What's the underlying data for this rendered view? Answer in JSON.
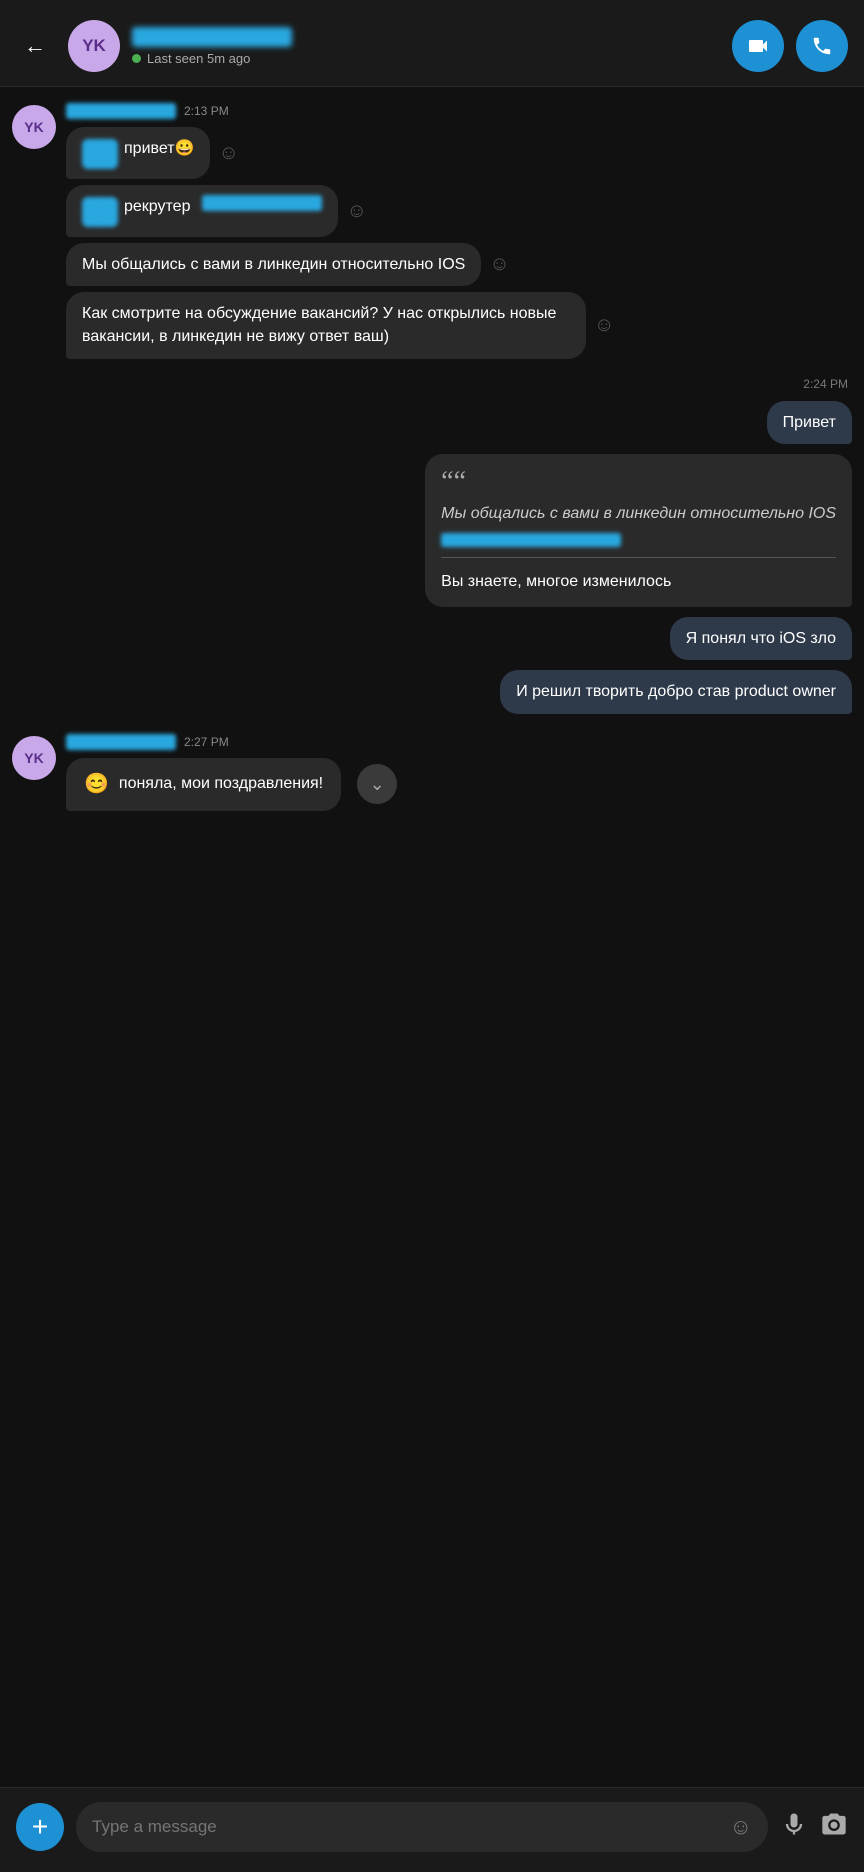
{
  "header": {
    "back_label": "←",
    "avatar_initials": "YK",
    "status_text": "Last seen 5m ago",
    "video_icon": "📹",
    "call_icon": "📞"
  },
  "messages": {
    "time1": "2:13 PM",
    "msg1_emoji": "😊",
    "msg1_text": "привет😀",
    "msg2_text": "рекрутер",
    "msg3_text": "Мы общались с вами в линкедин относительно IOS",
    "msg4_text": "Как смотрите на обсуждение вакансий? У нас открылись новые вакансии, в линкедин не вижу ответ ваш)",
    "time2": "2:24 PM",
    "out1_text": "Привет",
    "quote_mark": "““",
    "quote_italic": "Мы общались с вами в линкедин относительно IOS",
    "quote_body": "Вы знаете, многое изменилось",
    "out2_text": "Я понял что iOS зло",
    "out3_text": "И решил творить добро став product owner",
    "time3": "2:27 PM",
    "last_msg_emoji": "😊",
    "last_msg_text": "поняла, мои поздравления!"
  },
  "input": {
    "placeholder": "Type a message",
    "add_icon": "+",
    "emoji_icon": "☺",
    "mic_icon": "🎤",
    "camera_icon": "📷"
  }
}
